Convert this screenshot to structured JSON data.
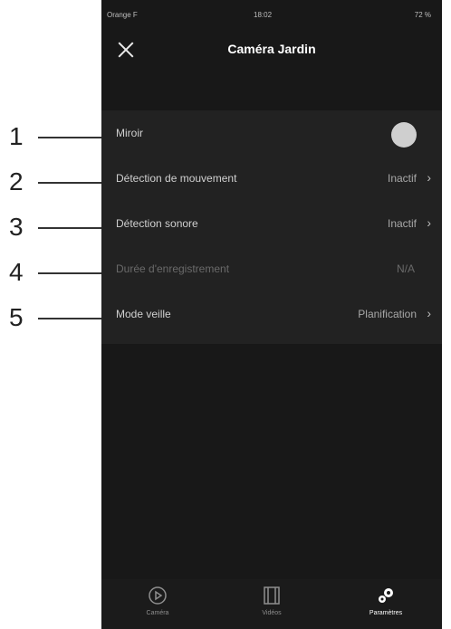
{
  "callouts": [
    "1",
    "2",
    "3",
    "4",
    "5"
  ],
  "status_bar": {
    "carrier": "Orange F",
    "time": "18:02",
    "battery": "72 %"
  },
  "nav": {
    "title": "Caméra Jardin",
    "close_icon": "close-icon"
  },
  "settings": [
    {
      "label": "Miroir",
      "value": "",
      "type": "toggle"
    },
    {
      "label": "Détection de mouvement",
      "value": "Inactif",
      "type": "chevron"
    },
    {
      "label": "Détection sonore",
      "value": "Inactif",
      "type": "chevron"
    },
    {
      "label": "Durée d'enregistrement",
      "value": "N/A",
      "type": "disabled"
    },
    {
      "label": "Mode veille",
      "value": "Planification",
      "type": "chevron"
    }
  ],
  "tabs": [
    {
      "label": "Caméra",
      "icon": "play-icon"
    },
    {
      "label": "Vidéos",
      "icon": "film-icon"
    },
    {
      "label": "Paramètres",
      "icon": "gears-icon",
      "active": true
    }
  ]
}
